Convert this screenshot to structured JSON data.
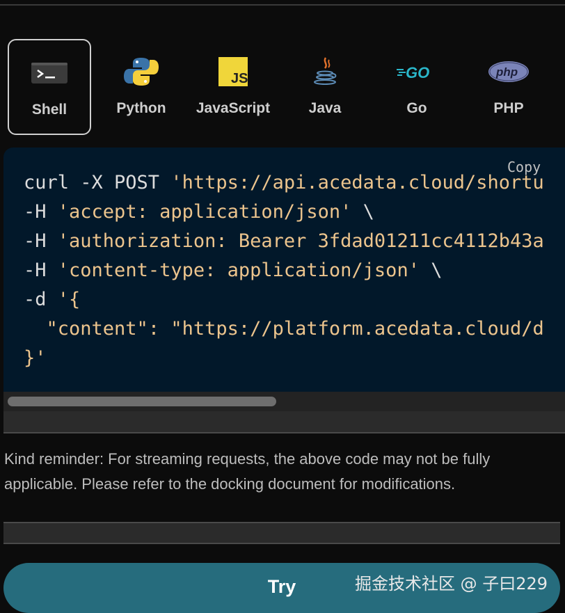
{
  "tabs": [
    {
      "label": "Shell",
      "icon": "terminal-icon",
      "active": true
    },
    {
      "label": "Python",
      "icon": "python-logo-icon",
      "active": false
    },
    {
      "label": "JavaScript",
      "icon": "javascript-logo-icon",
      "active": false
    },
    {
      "label": "Java",
      "icon": "java-logo-icon",
      "active": false
    },
    {
      "label": "Go",
      "icon": "go-logo-icon",
      "active": false
    },
    {
      "label": "PHP",
      "icon": "php-logo-icon",
      "active": false
    }
  ],
  "code": {
    "copy_label": "Copy",
    "lines": [
      {
        "plain": "curl -X POST ",
        "str": "'https://api.acedata.cloud/shortu"
      },
      {
        "plain": "-H ",
        "str": "'accept: application/json'",
        "tail": " \\"
      },
      {
        "plain": "-H ",
        "str": "'authorization: Bearer 3fdad01211cc4112b43a"
      },
      {
        "plain": "-H ",
        "str": "'content-type: application/json'",
        "tail": " \\"
      },
      {
        "plain": "-d ",
        "str": "'{"
      },
      {
        "plain": "  ",
        "str": "\"content\": \"https://platform.acedata.cloud/d"
      },
      {
        "plain": "",
        "str": "}'"
      }
    ]
  },
  "reminder": "Kind reminder: For streaming requests, the above code may not be fully applicable. Please refer to the docking document for modifications.",
  "try_label": "Try",
  "watermark": "掘金技术社区 @ 子曰229",
  "colors": {
    "background": "#0c0c0c",
    "code_background": "#02182a",
    "string": "#ecc48d",
    "try_button": "#266c7d"
  }
}
